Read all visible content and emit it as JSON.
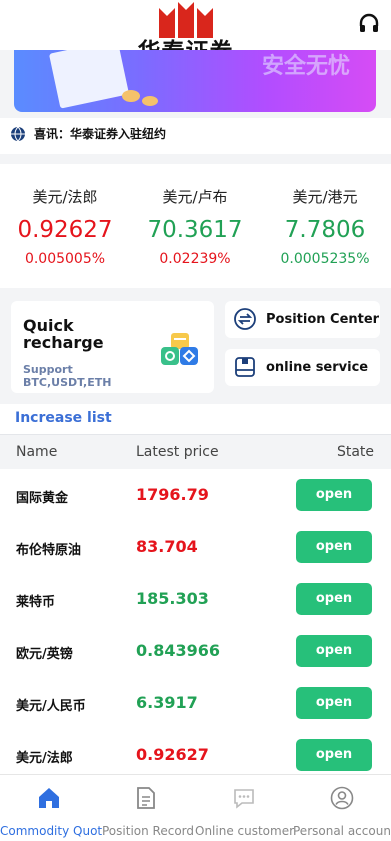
{
  "header": {
    "logo_text": "华泰证券",
    "banner_tag": "安全无忧",
    "colors": {
      "logo_red": "#d9261c",
      "banner_start": "#5a8cff",
      "banner_end": "#d64cf5"
    }
  },
  "notice": {
    "icon": "globe-icon",
    "text": "喜讯：华泰证券入驻纽约"
  },
  "ticker": [
    {
      "name": "美元/法郎",
      "price": "0.92627",
      "change": "0.005005%",
      "price_color": "red",
      "change_color": "red"
    },
    {
      "name": "美元/卢布",
      "price": "70.3617",
      "change": "0.02239%",
      "price_color": "green",
      "change_color": "red"
    },
    {
      "name": "美元/港元",
      "price": "7.7806",
      "change": "0.0005235%",
      "price_color": "green",
      "change_color": "green"
    }
  ],
  "quick_recharge": {
    "title": "Quick recharge",
    "subtitle": "Support BTC,USDT,ETH"
  },
  "shortcuts": [
    {
      "label": "Position Center",
      "icon": "exchange-icon"
    },
    {
      "label": "online service",
      "icon": "service-icon"
    }
  ],
  "increase_list": {
    "title": "Increase list",
    "columns": {
      "name": "Name",
      "price": "Latest price",
      "state": "State"
    },
    "rows": [
      {
        "name": "国际黄金",
        "price": "1796.79",
        "color": "red",
        "action": "open"
      },
      {
        "name": "布伦特原油",
        "price": "83.704",
        "color": "red",
        "action": "open"
      },
      {
        "name": "莱特币",
        "price": "185.303",
        "color": "green",
        "action": "open"
      },
      {
        "name": "欧元/英镑",
        "price": "0.843966",
        "color": "green",
        "action": "open"
      },
      {
        "name": "美元/人民币",
        "price": "6.3917",
        "color": "green",
        "action": "open"
      },
      {
        "name": "美元/法郎",
        "price": "0.92627",
        "color": "red",
        "action": "open"
      }
    ]
  },
  "nav": [
    {
      "label": "Commodity Quot",
      "icon": "home-icon",
      "active": true
    },
    {
      "label": "Position Record",
      "icon": "document-icon",
      "active": false
    },
    {
      "label": "Online customer",
      "icon": "chat-icon",
      "active": false
    },
    {
      "label": "Personal account",
      "icon": "user-icon",
      "active": false
    }
  ]
}
